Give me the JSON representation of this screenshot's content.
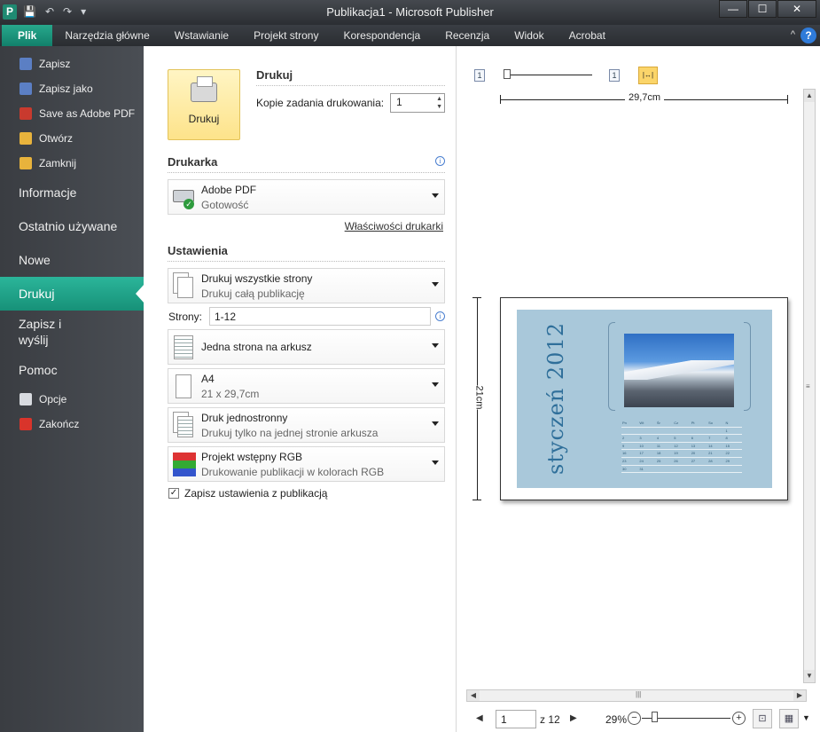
{
  "window": {
    "title": "Publikacja1  -  Microsoft Publisher",
    "app_icon": "P",
    "controls": {
      "minimize": "—",
      "maximize": "☐",
      "close": "✕"
    }
  },
  "qat": {
    "save_icon": "💾",
    "undo_icon": "↶",
    "redo_icon": "↷",
    "customize_icon": "▾"
  },
  "tabs": [
    {
      "label": "Plik"
    },
    {
      "label": "Narzędzia główne"
    },
    {
      "label": "Wstawianie"
    },
    {
      "label": "Projekt strony"
    },
    {
      "label": "Korespondencja"
    },
    {
      "label": "Recenzja"
    },
    {
      "label": "Widok"
    },
    {
      "label": "Acrobat"
    }
  ],
  "help_label": "?",
  "ribbon_caret": "^",
  "backstage": {
    "small_items": [
      {
        "label": "Zapisz",
        "color": "#5b7fc4"
      },
      {
        "label": "Zapisz jako",
        "color": "#5b7fc4"
      },
      {
        "label": "Save as Adobe PDF",
        "color": "#c93a2e"
      },
      {
        "label": "Otwórz",
        "color": "#e8b33c"
      },
      {
        "label": "Zamknij",
        "color": "#e8b33c"
      }
    ],
    "info": "Informacje",
    "recent": "Ostatnio używane",
    "new": "Nowe",
    "print": "Drukuj",
    "send_line1": "Zapisz i",
    "send_line2": "wyślij",
    "help": "Pomoc",
    "options": "Opcje",
    "exit": "Zakończ"
  },
  "print_panel": {
    "print_button": "Drukuj",
    "heading": "Drukuj",
    "copies_label": "Kopie zadania drukowania:",
    "copies_value": "1",
    "printer_heading": "Drukarka",
    "printer_name": "Adobe PDF",
    "printer_status": "Gotowość",
    "printer_props": "Właściwości drukarki",
    "settings_heading": "Ustawienia",
    "pages_option": {
      "title": "Drukuj wszystkie strony",
      "sub": "Drukuj całą publikację"
    },
    "pages_label": "Strony:",
    "pages_value": "1-12",
    "layout_option": {
      "title": "Jedna strona na arkusz"
    },
    "paper_option": {
      "title": "A4",
      "sub": "21 x 29,7cm"
    },
    "sides_option": {
      "title": "Druk jednostronny",
      "sub": "Drukuj tylko na jednej stronie arkusza"
    },
    "color_option": {
      "title": "Projekt wstępny RGB",
      "sub": "Drukowanie publikacji w kolorach RGB"
    },
    "save_settings_check": "✓",
    "save_settings_label": "Zapisz ustawienia z publikacją",
    "info_glyph": "i"
  },
  "preview": {
    "width_label": "29,7cm",
    "height_label": "21cm",
    "page_icon_label": "1",
    "month_title": "styczeń 2012",
    "calendar_header": [
      "Pn",
      "Wt",
      "Śr",
      "Cz",
      "Pt",
      "So",
      "N"
    ],
    "calendar_rows": [
      [
        "",
        "",
        "",
        "",
        "",
        "",
        "1"
      ],
      [
        "2",
        "3",
        "4",
        "5",
        "6",
        "7",
        "8"
      ],
      [
        "9",
        "10",
        "11",
        "12",
        "13",
        "14",
        "15"
      ],
      [
        "16",
        "17",
        "18",
        "19",
        "20",
        "21",
        "22"
      ],
      [
        "23",
        "24",
        "25",
        "26",
        "27",
        "28",
        "29"
      ],
      [
        "30",
        "31",
        "",
        "",
        "",
        "",
        ""
      ]
    ],
    "current_page": "1",
    "of_pages": "z 12",
    "zoom": "29%",
    "zoom_out": "−",
    "zoom_in": "+",
    "fit_icon": "⊡",
    "multi_icon": "▦",
    "prev_arrow": "◀",
    "next_arrow": "▶",
    "grip": "|||",
    "vgrip": "≡",
    "scroll_up": "▲",
    "scroll_down": "▼",
    "scroll_left": "◀",
    "scroll_right": "▶"
  }
}
